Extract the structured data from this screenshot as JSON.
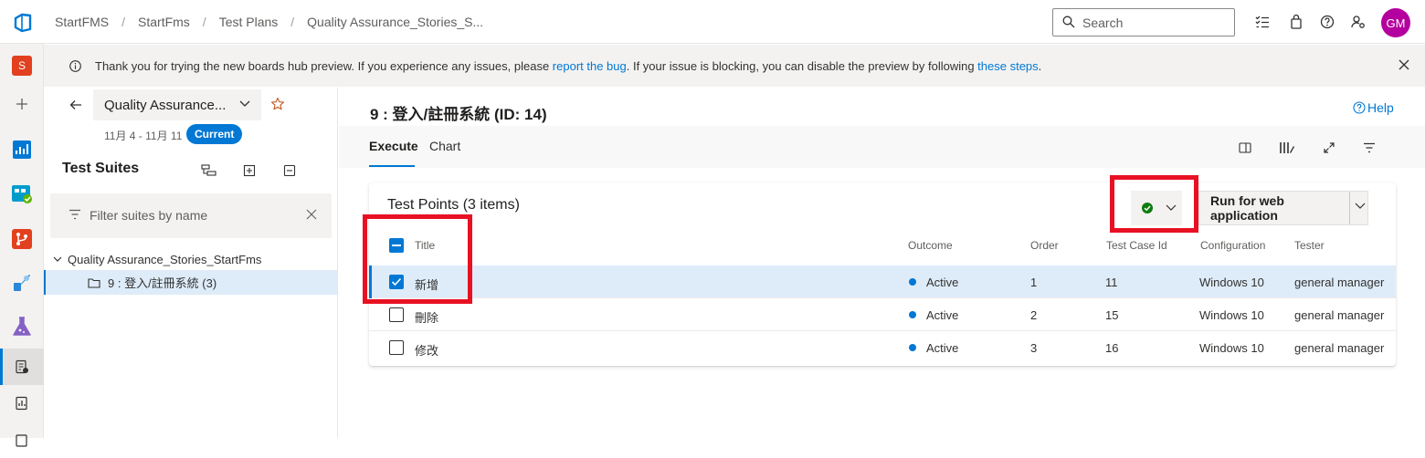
{
  "colors": {
    "accent": "#0078d4",
    "highlight": "#e81123",
    "passed": "#107c10",
    "avatar": "#b4009e",
    "project_badge": "#e2401e"
  },
  "topbar": {
    "breadcrumbs": [
      "StartFMS",
      "StartFms",
      "Test Plans",
      "Quality Assurance_Stories_S..."
    ],
    "search_placeholder": "Search",
    "icons": [
      "task-list-icon",
      "shopping-bag-icon",
      "help-circle-icon",
      "user-settings-icon"
    ],
    "avatar_initials": "GM"
  },
  "rail": {
    "project_initial": "S"
  },
  "banner": {
    "text1": "Thank you for trying the new boards hub preview. If you experience any issues, please ",
    "link1": "report the bug",
    "text2": ". If your issue is blocking, you can disable the preview by following ",
    "link2": "these steps",
    "text3": "."
  },
  "left": {
    "plan_name": "Quality Assurance...",
    "dates": "11月 4 - 11月 11",
    "current_badge": "Current",
    "suites_title": "Test Suites",
    "filter_placeholder": "Filter suites by name",
    "tree": {
      "root": "Quality Assurance_Stories_StartFms",
      "child": "9 : 登入/註冊系統 (3)"
    }
  },
  "main": {
    "suite_title": "9 : 登入/註冊系統 (ID: 14)",
    "help": "Help",
    "tabs": [
      "Execute",
      "Chart"
    ],
    "active_tab": "Execute",
    "card_title": "Test Points (3 items)",
    "run_button": "Run for web application",
    "columns": [
      "Title",
      "Outcome",
      "Order",
      "Test Case Id",
      "Configuration",
      "Tester"
    ],
    "rows": [
      {
        "title": "新增",
        "outcome": "Active",
        "order": "1",
        "test_case_id": "11",
        "configuration": "Windows 10",
        "tester": "general manager",
        "selected": true
      },
      {
        "title": "刪除",
        "outcome": "Active",
        "order": "2",
        "test_case_id": "15",
        "configuration": "Windows 10",
        "tester": "general manager",
        "selected": false
      },
      {
        "title": "修改",
        "outcome": "Active",
        "order": "3",
        "test_case_id": "16",
        "configuration": "Windows 10",
        "tester": "general manager",
        "selected": false
      }
    ]
  }
}
